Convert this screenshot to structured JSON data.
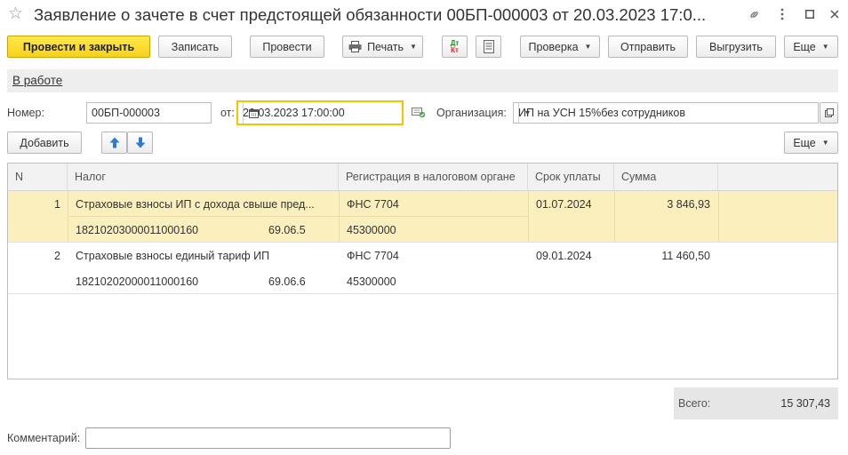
{
  "window": {
    "title": "Заявление о зачете в счет предстоящей обязанности 00БП-000003 от 20.03.2023 17:0..."
  },
  "toolbar": {
    "post_close": "Провести и закрыть",
    "save": "Записать",
    "post": "Провести",
    "print": "Печать",
    "dt_kt_top": "Дт",
    "dt_kt_bottom": "Кт",
    "check": "Проверка",
    "send": "Отправить",
    "export": "Выгрузить",
    "more": "Еще"
  },
  "status": {
    "link": "В работе"
  },
  "form": {
    "number_label": "Номер:",
    "number_value": "00БП-000003",
    "date_label": "от:",
    "date_value": "20.03.2023 17:00:00",
    "org_label": "Организация:",
    "org_value": "ИП на УСН 15%без сотрудников"
  },
  "table_toolbar": {
    "add": "Добавить",
    "more": "Еще"
  },
  "table": {
    "columns": [
      "N",
      "Налог",
      "Регистрация в налоговом органе",
      "Срок уплаты",
      "Сумма"
    ],
    "rows": [
      {
        "n": "1",
        "tax": "Страховые взносы ИП с дохода свыше пред...",
        "kbk": "18210203000011000160",
        "account": "69.06.5",
        "reg": "ФНС 7704",
        "oktmo": "45300000",
        "due": "01.07.2024",
        "amount": "3 846,93"
      },
      {
        "n": "2",
        "tax": "Страховые взносы единый тариф ИП",
        "kbk": "18210202000011000160",
        "account": "69.06.6",
        "reg": "ФНС 7704",
        "oktmo": "45300000",
        "due": "09.01.2024",
        "amount": "11 460,50"
      }
    ]
  },
  "totals": {
    "label": "Всего:",
    "value": "15 307,43"
  },
  "comment": {
    "label": "Комментарий:",
    "value": ""
  },
  "colors": {
    "primary": "#f7d21b",
    "selected_row": "#fbefbd",
    "focus_border": "#f5c400",
    "arrow_blue": "#2a7bd1"
  }
}
